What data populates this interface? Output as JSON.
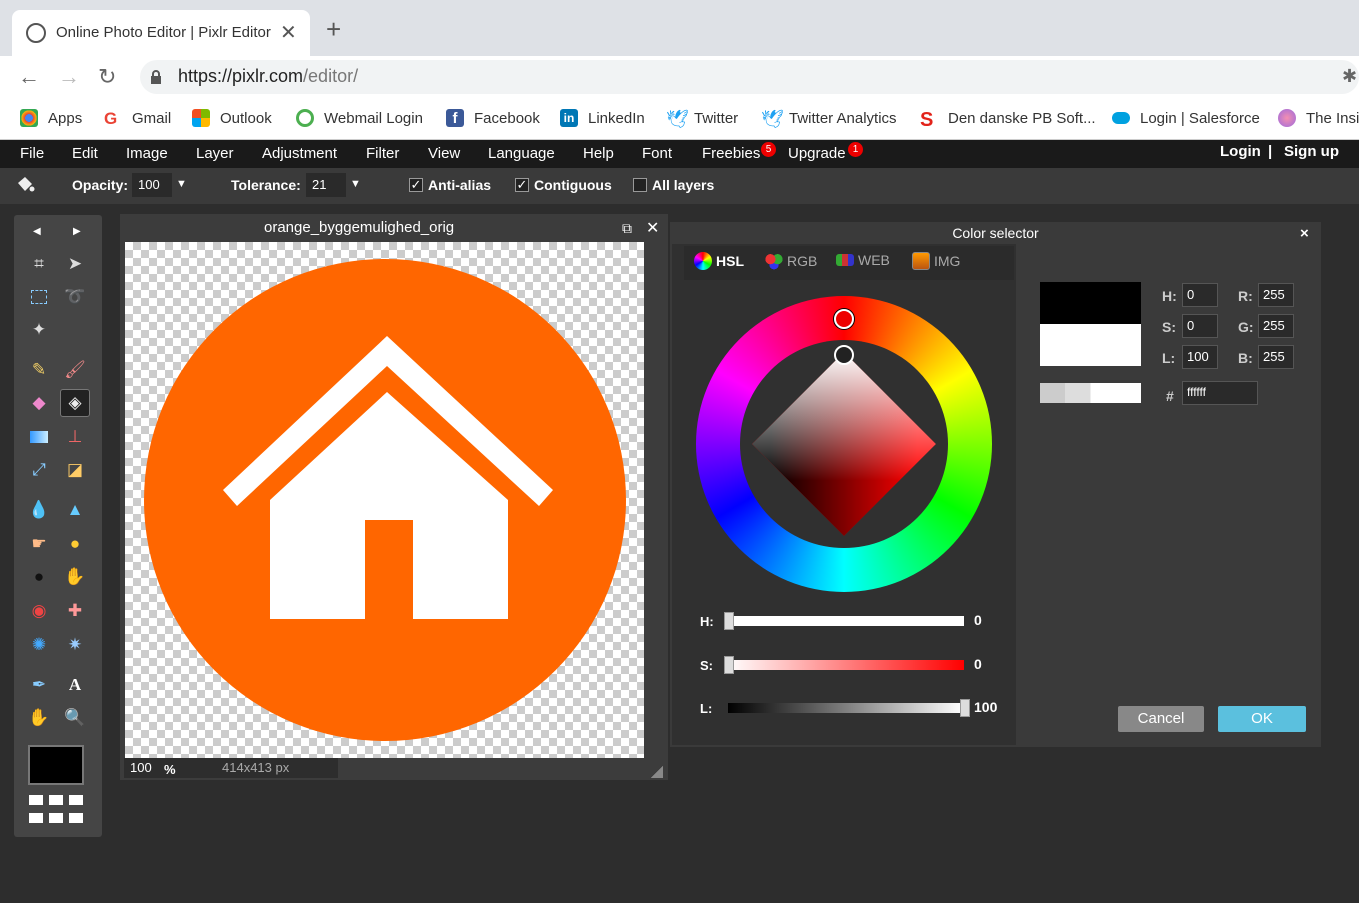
{
  "browser": {
    "tab_title": "Online Photo Editor | Pixlr Editor",
    "tab_close": "✕",
    "new_tab": "+",
    "url_host": "https://pixlr.com",
    "url_path": "/editor/",
    "bookmarks": [
      {
        "label": "Apps",
        "icon": "apps-icon",
        "color": "#4285f4"
      },
      {
        "label": "Gmail",
        "icon": "google-icon",
        "color": "#ea4335"
      },
      {
        "label": "Outlook",
        "icon": "microsoft-icon",
        "color": "#f25022"
      },
      {
        "label": "Webmail Login",
        "icon": "webmail-icon",
        "color": "#4caf50"
      },
      {
        "label": "Facebook",
        "icon": "facebook-icon",
        "color": "#3b5998"
      },
      {
        "label": "LinkedIn",
        "icon": "linkedin-icon",
        "color": "#0077b5"
      },
      {
        "label": "Twitter",
        "icon": "twitter-icon",
        "color": "#1da1f2"
      },
      {
        "label": "Twitter Analytics",
        "icon": "twitter-icon",
        "color": "#1da1f2"
      },
      {
        "label": "Den danske PB Soft...",
        "icon": "s-logo-icon",
        "color": "#e2231a"
      },
      {
        "label": "Login | Salesforce",
        "icon": "salesforce-icon",
        "color": "#00a1e0"
      },
      {
        "label": "The Insi",
        "icon": "insider-icon",
        "color": "#9c6ade"
      }
    ]
  },
  "menu": {
    "items": [
      "File",
      "Edit",
      "Image",
      "Layer",
      "Adjustment",
      "Filter",
      "View",
      "Language",
      "Help",
      "Font",
      "Freebies",
      "Upgrade"
    ],
    "freebies_badge": "5",
    "upgrade_badge": "1",
    "login": "Login",
    "separator": "|",
    "signup": "Sign up"
  },
  "tool_options": {
    "opacity_label": "Opacity:",
    "opacity_value": "100",
    "tolerance_label": "Tolerance:",
    "tolerance_value": "21",
    "anti_alias": "Anti-alias",
    "anti_alias_checked": true,
    "contiguous": "Contiguous",
    "contiguous_checked": true,
    "all_layers": "All layers",
    "all_layers_checked": false
  },
  "document": {
    "title": "orange_byggemulighed_orig",
    "zoom": "100",
    "zoom_unit": "%",
    "size": "414x413 px",
    "image_color": "#ff6600"
  },
  "color_selector": {
    "title": "Color selector",
    "close": "×",
    "tabs": [
      "HSL",
      "RGB",
      "WEB",
      "IMG"
    ],
    "active_tab": "HSL",
    "sliders": [
      {
        "label": "H:",
        "value": "0",
        "fraction": 0
      },
      {
        "label": "S:",
        "value": "0",
        "fraction": 0
      },
      {
        "label": "L:",
        "value": "100",
        "fraction": 1
      }
    ],
    "fields": {
      "h_label": "H:",
      "h": "0",
      "s_label": "S:",
      "s": "0",
      "l_label": "L:",
      "l": "100",
      "r_label": "R:",
      "r": "255",
      "g_label": "G:",
      "g": "255",
      "b_label": "B:",
      "b": "255",
      "hex_label": "#",
      "hex": "ffffff"
    },
    "old_color": "#000000",
    "new_color": "#ffffff",
    "cancel": "Cancel",
    "ok": "OK"
  }
}
